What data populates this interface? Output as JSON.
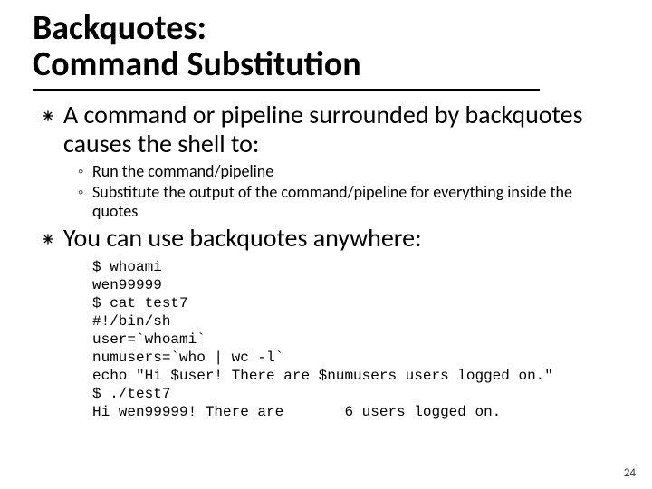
{
  "title": {
    "line1": "Backquotes:",
    "line2": "Command Substitution"
  },
  "bullets": [
    {
      "text": "A command or pipeline surrounded by backquotes causes the shell to:",
      "subs": [
        "Run the command/pipeline",
        "Substitute the output of the command/pipeline for everything inside the quotes"
      ]
    },
    {
      "text": "You can use backquotes anywhere:",
      "subs": []
    }
  ],
  "code": "$ whoami\nwen99999\n$ cat test7\n#!/bin/sh\nuser=`whoami`\nnumusers=`who | wc -l`\necho \"Hi $user! There are $numusers users logged on.\"\n$ ./test7\nHi wen99999! There are       6 users logged on.",
  "page_number": "24"
}
